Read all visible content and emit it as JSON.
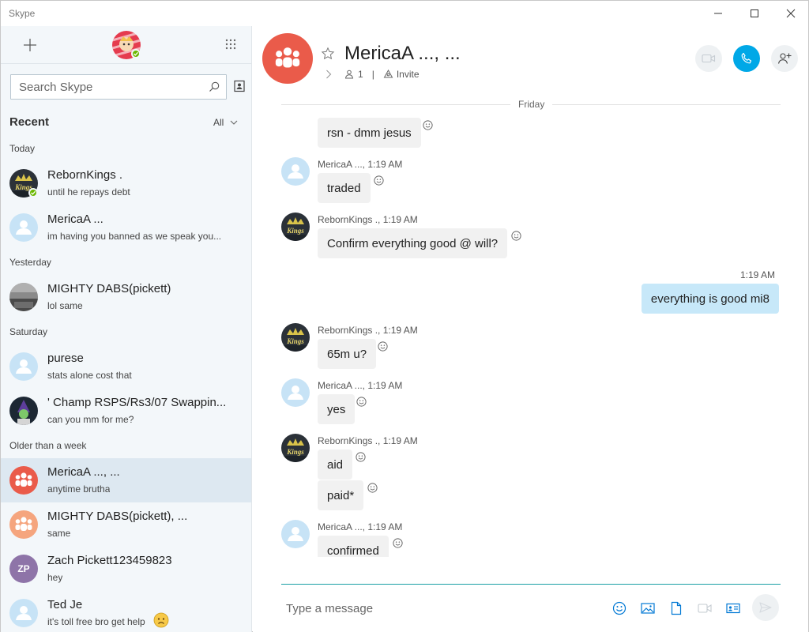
{
  "window": {
    "title": "Skype"
  },
  "sidebar": {
    "search_placeholder": "Search Skype",
    "recent_label": "Recent",
    "filter_label": "All",
    "sections": [
      "Today",
      "Yesterday",
      "Saturday",
      "Older than a week"
    ],
    "conversations": [
      {
        "name": "RebornKings .",
        "preview": "until he repays debt",
        "avatar": "reborn-kings-avatar",
        "online": true
      },
      {
        "name": "MericaA ...",
        "preview": "im having you banned as we speak you...",
        "avatar": "default-person"
      },
      {
        "name": "MIGHTY DABS(pickett)",
        "preview": "lol same",
        "avatar": "photo-avatar"
      },
      {
        "name": "purese",
        "preview": "stats alone cost that",
        "avatar": "default-person"
      },
      {
        "name": "' Champ RSPS/Rs3/07 Swappin...",
        "preview": "can you mm for me?",
        "avatar": "champ-avatar"
      },
      {
        "name": "MericaA ..., ...",
        "preview": "anytime brutha",
        "avatar": "group-red",
        "active": true
      },
      {
        "name": "MIGHTY DABS(pickett), ...",
        "preview": "same",
        "avatar": "group-orange"
      },
      {
        "name": "Zach Pickett123459823",
        "preview": "hey",
        "avatar": "initials",
        "initials": "ZP"
      },
      {
        "name": "Ted Je",
        "preview": "it's toll free bro get help",
        "avatar": "default-person",
        "emoji": "worried-face"
      }
    ]
  },
  "chat": {
    "title": "MericaA ..., ...",
    "participant_count": "1",
    "invite_label": "Invite",
    "day_label": "Friday",
    "messages": [
      {
        "sender": "",
        "time": "",
        "text": "rsn - dmm jesus"
      },
      {
        "sender": "MericaA ...,",
        "time": "1:19 AM",
        "text": "traded"
      },
      {
        "sender": "RebornKings .,",
        "time": "1:19 AM",
        "text": "Confirm everything good @ will?"
      },
      {
        "sender": "",
        "time": "1:19 AM",
        "text": "everything is good mi8",
        "own": true
      },
      {
        "sender": "RebornKings .,",
        "time": "1:19 AM",
        "text": "65m u?"
      },
      {
        "sender": "MericaA ...,",
        "time": "1:19 AM",
        "text": "yes"
      },
      {
        "sender": "RebornKings .,",
        "time": "1:19 AM",
        "text": "aid"
      },
      {
        "sender": "",
        "time": "",
        "text": "paid*"
      },
      {
        "sender": "MericaA ...,",
        "time": "1:19 AM",
        "text": "confirmed"
      }
    ],
    "compose_placeholder": "Type a message"
  },
  "colors": {
    "accent": "#00a8e7",
    "group_red": "#ea5b4a",
    "active_row": "#dde8f1",
    "own_bubble": "#c7e8f9",
    "online": "#6bb700"
  }
}
